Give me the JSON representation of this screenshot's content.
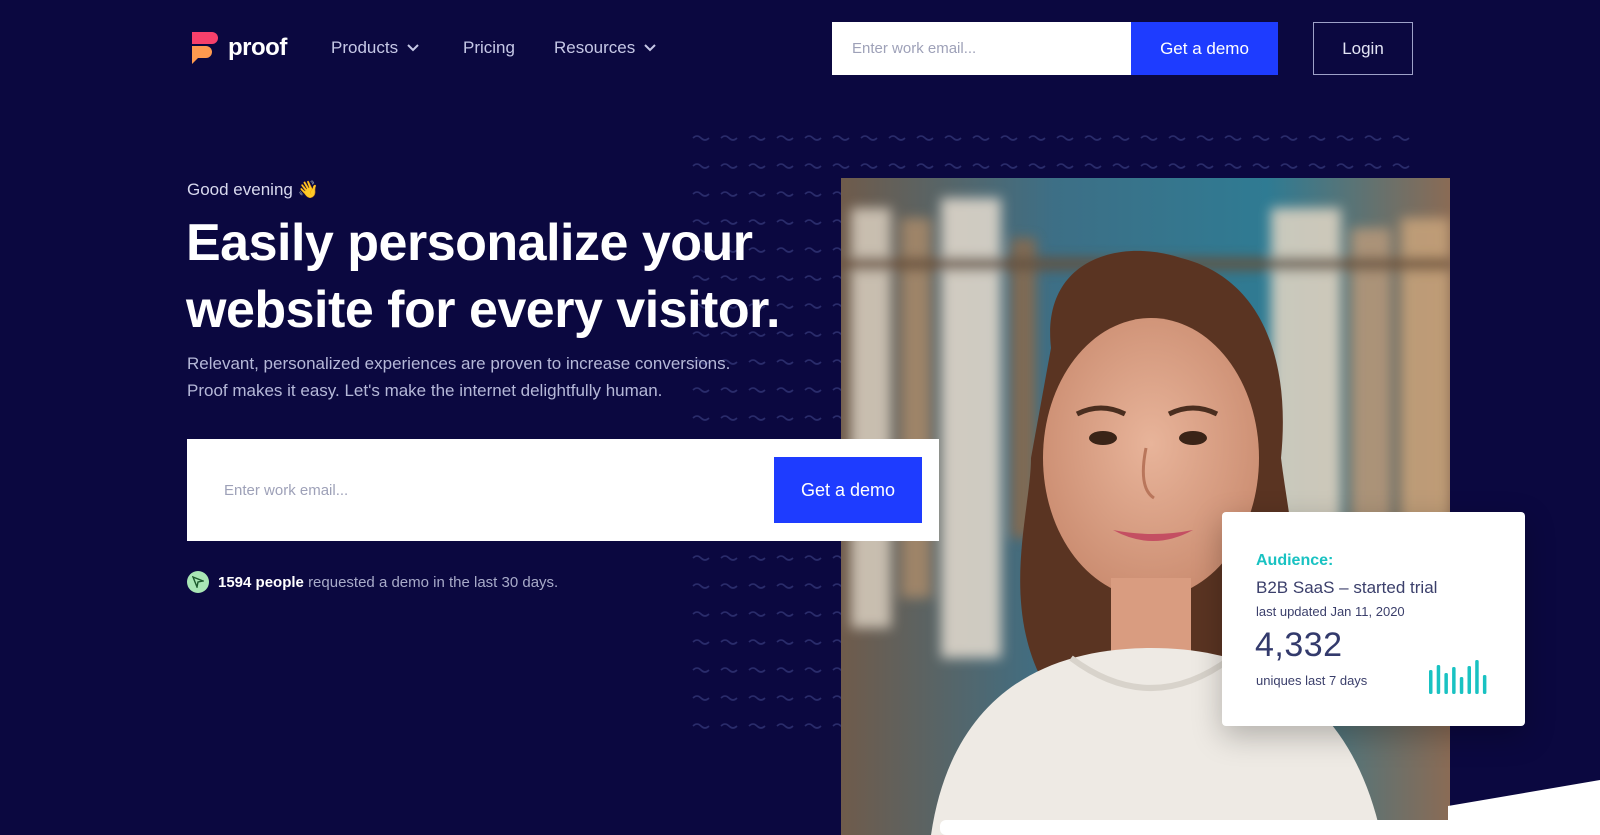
{
  "brand": {
    "name": "proof"
  },
  "nav": [
    {
      "label": "Products",
      "has_dropdown": true
    },
    {
      "label": "Pricing",
      "has_dropdown": false
    },
    {
      "label": "Resources",
      "has_dropdown": true
    }
  ],
  "header": {
    "email_placeholder": "Enter work email...",
    "demo_label": "Get a demo",
    "login_label": "Login"
  },
  "hero": {
    "greeting": "Good evening 👋",
    "headline_line1": "Easily personalize your",
    "headline_line2": "website for every visitor.",
    "subcopy_line1": "Relevant, personalized experiences are proven to increase conversions.",
    "subcopy_line2": "Proof makes it easy. Let's make the internet delightfully human.",
    "email_placeholder": "Enter work email...",
    "demo_label": "Get a demo",
    "social_count": "1594 people",
    "social_text": "requested a demo in the last 30 days."
  },
  "card": {
    "label": "Audience:",
    "segment": "B2B SaaS – started trial",
    "updated": "last updated Jan 11, 2020",
    "number": "4,332",
    "number_caption": "uniques last 7 days",
    "bars": [
      0.72,
      0.85,
      0.62,
      0.78,
      0.5,
      0.82,
      1.0,
      0.55
    ],
    "accent": "#19c2c2"
  },
  "colors": {
    "background": "#0b0840",
    "primary_button": "#1e3cff",
    "logo_pink": "#f7406b",
    "logo_orange": "#ff9a4f"
  }
}
